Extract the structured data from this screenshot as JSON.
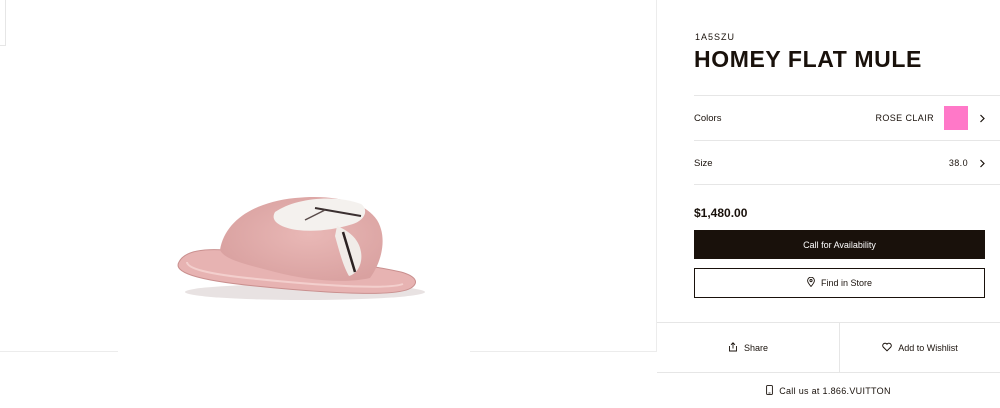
{
  "product": {
    "sku": "1A5SZU",
    "name": "HOMEY FLAT MULE",
    "image_alt": "pink fur flat mule slipper"
  },
  "options": {
    "colors_label": "Colors",
    "colors_value": "ROSE CLAIR",
    "swatch_color": "#ff78c8",
    "size_label": "Size",
    "size_value": "38.0"
  },
  "price": "$1,480.00",
  "buttons": {
    "availability": "Call for Availability",
    "find_store": "Find in Store"
  },
  "actions": {
    "share": "Share",
    "wishlist": "Add to Wishlist"
  },
  "contact": {
    "call": "Call us at 1.866.VUITTON"
  },
  "colors": {
    "text": "#19110b",
    "dark_button": "#19110b"
  }
}
